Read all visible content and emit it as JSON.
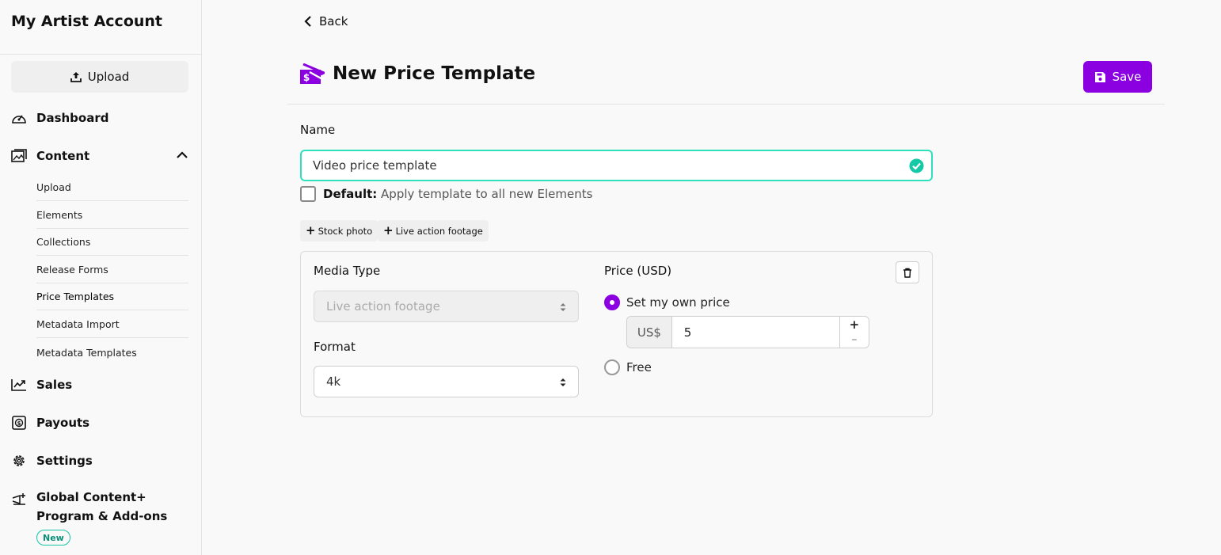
{
  "sidebar": {
    "account_title": "My Artist Account",
    "upload_label": "Upload",
    "main_items": [
      {
        "label": "Dashboard",
        "icon": "dashboard-icon"
      },
      {
        "label": "Content",
        "icon": "content-icon"
      },
      {
        "label": "Sales",
        "icon": "sales-icon"
      },
      {
        "label": "Payouts",
        "icon": "payouts-icon"
      },
      {
        "label": "Settings",
        "icon": "gear-icon"
      },
      {
        "label": "Global Content+",
        "label_line2": "Program & Add-ons",
        "icon": "global-content-icon",
        "badge": "New"
      }
    ],
    "content_sub_items": [
      {
        "label": "Upload"
      },
      {
        "label": "Elements"
      },
      {
        "label": "Collections"
      },
      {
        "label": "Release Forms"
      },
      {
        "label": "Price Templates",
        "active": true
      },
      {
        "label": "Metadata Import"
      },
      {
        "label": "Metadata Templates"
      }
    ]
  },
  "header": {
    "back_label": "Back",
    "title": "New Price Template",
    "save_label": "Save"
  },
  "form": {
    "name_label": "Name",
    "name_value": "Video price template",
    "default_label": "Default:",
    "default_desc": "Apply template to all new Elements",
    "default_checked": false,
    "add_chips": [
      {
        "label": "Stock photo"
      },
      {
        "label": "Live action footage"
      }
    ]
  },
  "card": {
    "media_type_label": "Media Type",
    "media_type_value": "Live action footage",
    "format_label": "Format",
    "format_value": "4k",
    "price_label": "Price (USD)",
    "option_own": "Set my own price",
    "currency_prefix": "US$",
    "price_value": "5",
    "option_free": "Free",
    "selected_option": "own"
  },
  "colors": {
    "accent": "#8a00e0",
    "valid": "#2fe0bf",
    "badge": "#13c4a3"
  }
}
